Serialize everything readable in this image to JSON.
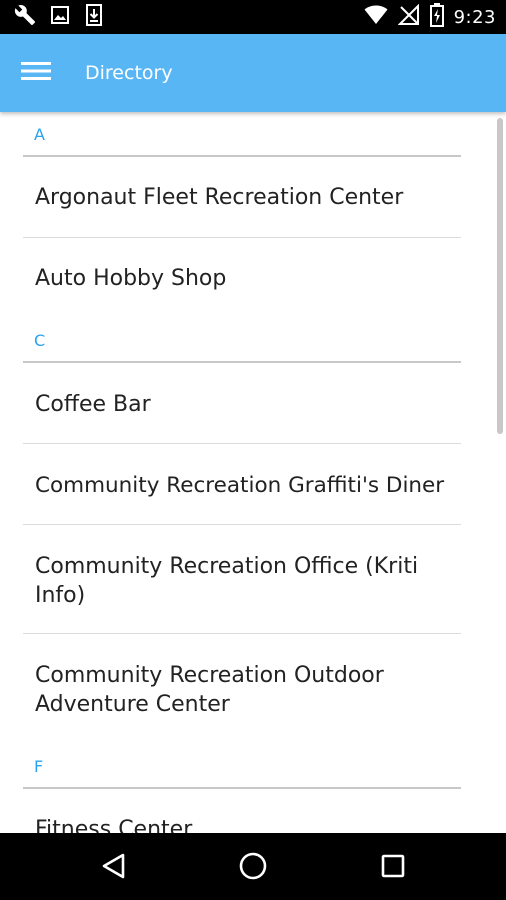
{
  "status_bar": {
    "time": "9:23",
    "left_icons": [
      "wrench-icon",
      "image-icon",
      "download-icon"
    ],
    "right_icons": [
      "wifi-icon",
      "no-signal-icon",
      "battery-charging-icon"
    ]
  },
  "app_bar": {
    "title": "Directory",
    "menu_icon": "hamburger-menu-icon",
    "color": "#59b6f4"
  },
  "directory": {
    "accent_color": "#2aa3ef",
    "sections": [
      {
        "letter": "A",
        "items": [
          {
            "label": "Argonaut Fleet Recreation Center"
          },
          {
            "label": "Auto Hobby Shop"
          }
        ]
      },
      {
        "letter": "C",
        "items": [
          {
            "label": "Coffee Bar"
          },
          {
            "label": "Community Recreation Graffiti's Diner"
          },
          {
            "label": "Community Recreation Office (Kriti Info)"
          },
          {
            "label": "Community Recreation Outdoor Adventure Center"
          }
        ]
      },
      {
        "letter": "F",
        "items": [
          {
            "label": "Fitness Center"
          }
        ]
      }
    ]
  },
  "nav_bar": {
    "back_icon": "back-triangle-icon",
    "home_icon": "home-circle-icon",
    "recents_icon": "recents-square-icon"
  }
}
